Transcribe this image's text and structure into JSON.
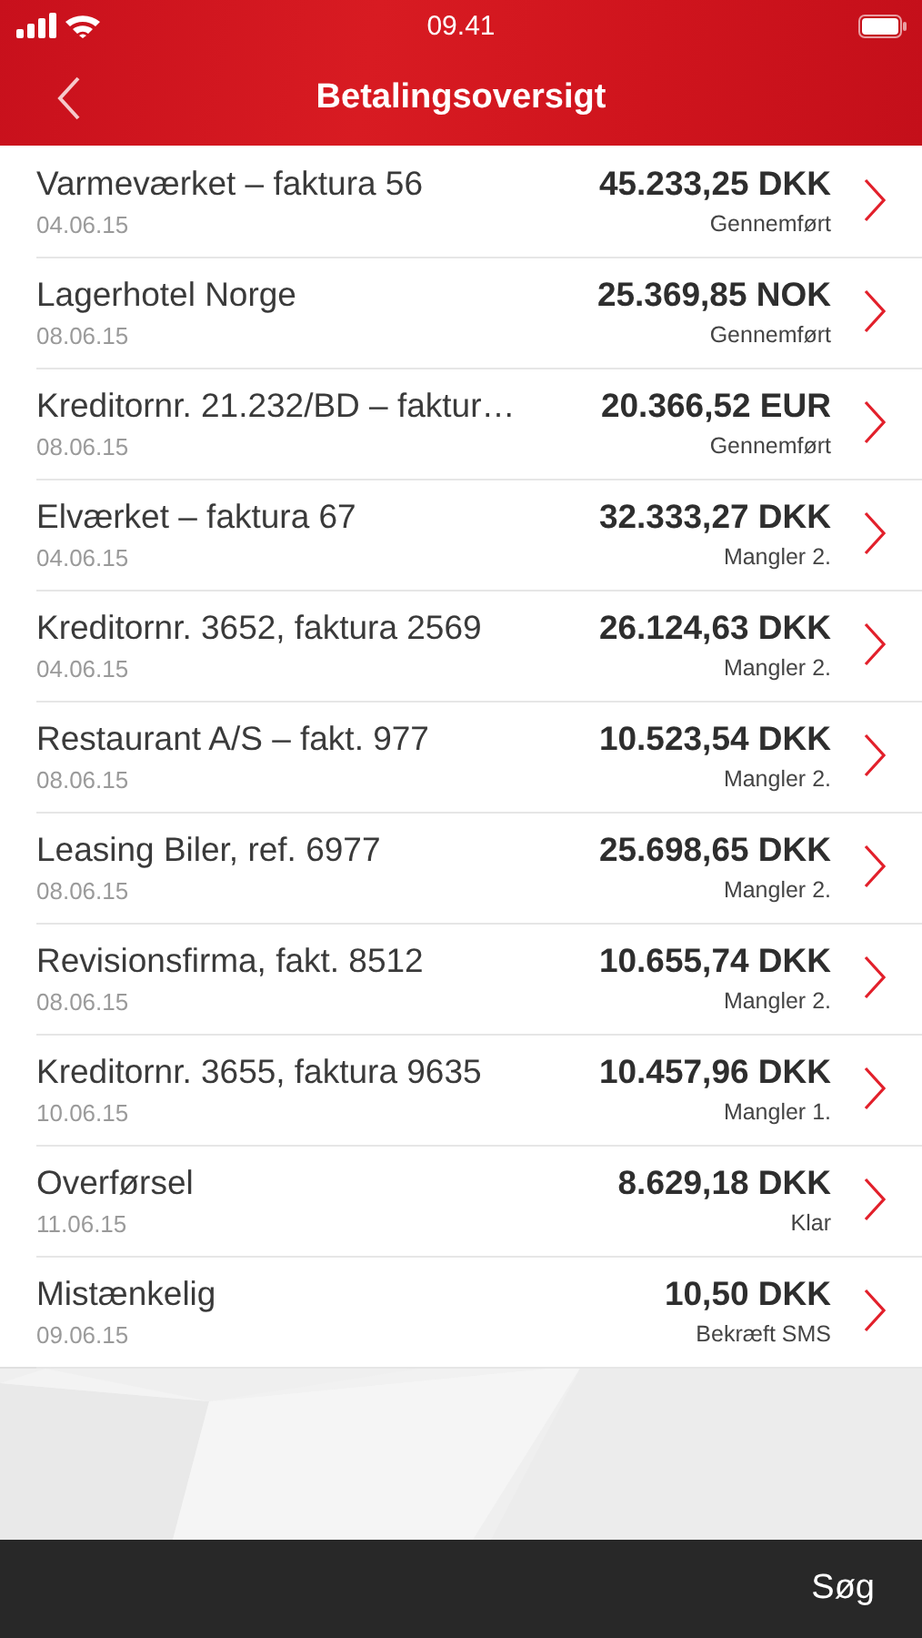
{
  "status_bar": {
    "time": "09.41"
  },
  "nav_bar": {
    "title": "Betalingsoversigt"
  },
  "payments": [
    {
      "name": "Varmeværket – faktura 56",
      "date": "04.06.15",
      "amount": "45.233,25 DKK",
      "status": "Gennemført"
    },
    {
      "name": "Lagerhotel Norge",
      "date": "08.06.15",
      "amount": "25.369,85 NOK",
      "status": "Gennemført"
    },
    {
      "name": "Kreditornr. 21.232/BD – faktur…",
      "date": "08.06.15",
      "amount": "20.366,52 EUR",
      "status": "Gennemført"
    },
    {
      "name": "Elværket – faktura 67",
      "date": "04.06.15",
      "amount": "32.333,27 DKK",
      "status": "Mangler 2."
    },
    {
      "name": "Kreditornr. 3652, faktura 2569",
      "date": "04.06.15",
      "amount": "26.124,63 DKK",
      "status": "Mangler 2."
    },
    {
      "name": "Restaurant A/S – fakt. 977",
      "date": "08.06.15",
      "amount": "10.523,54 DKK",
      "status": "Mangler 2."
    },
    {
      "name": "Leasing Biler, ref. 6977",
      "date": "08.06.15",
      "amount": "25.698,65 DKK",
      "status": "Mangler 2."
    },
    {
      "name": "Revisionsfirma, fakt. 8512",
      "date": "08.06.15",
      "amount": "10.655,74 DKK",
      "status": "Mangler 2."
    },
    {
      "name": "Kreditornr. 3655, faktura 9635",
      "date": "10.06.15",
      "amount": "10.457,96 DKK",
      "status": "Mangler 1."
    },
    {
      "name": "Overførsel",
      "date": "11.06.15",
      "amount": "8.629,18 DKK",
      "status": "Klar"
    },
    {
      "name": "Mistænkelig",
      "date": "09.06.15",
      "amount": "10,50 DKK",
      "status": "Bekræft SMS"
    }
  ],
  "bottom_bar": {
    "action": "Søg"
  }
}
